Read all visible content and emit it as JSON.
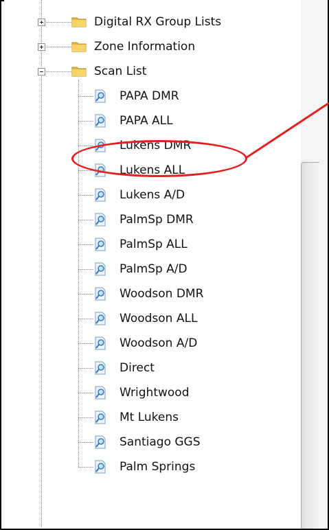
{
  "tree": {
    "folders": [
      {
        "label": "Digital RX Group Lists",
        "expanded": false
      },
      {
        "label": "Zone Information",
        "expanded": false
      },
      {
        "label": "Scan List",
        "expanded": true
      }
    ],
    "scan_list_items": [
      "PAPA DMR",
      "PAPA ALL",
      "Lukens DMR",
      "Lukens ALL",
      "Lukens A/D",
      "PalmSp DMR",
      "PalmSp ALL",
      "PalmSp A/D",
      "Woodson DMR",
      "Woodson ALL",
      "Woodson A/D",
      "Direct",
      "Wrightwood",
      "Mt Lukens",
      "Santiago GGS",
      "Palm Springs"
    ],
    "highlighted_item": "Lukens DMR"
  },
  "icons": {
    "folder": "folder-icon",
    "scan_item": "scan-document-icon"
  },
  "colors": {
    "annotation": "#e02020",
    "folder": "#f2c94c"
  }
}
